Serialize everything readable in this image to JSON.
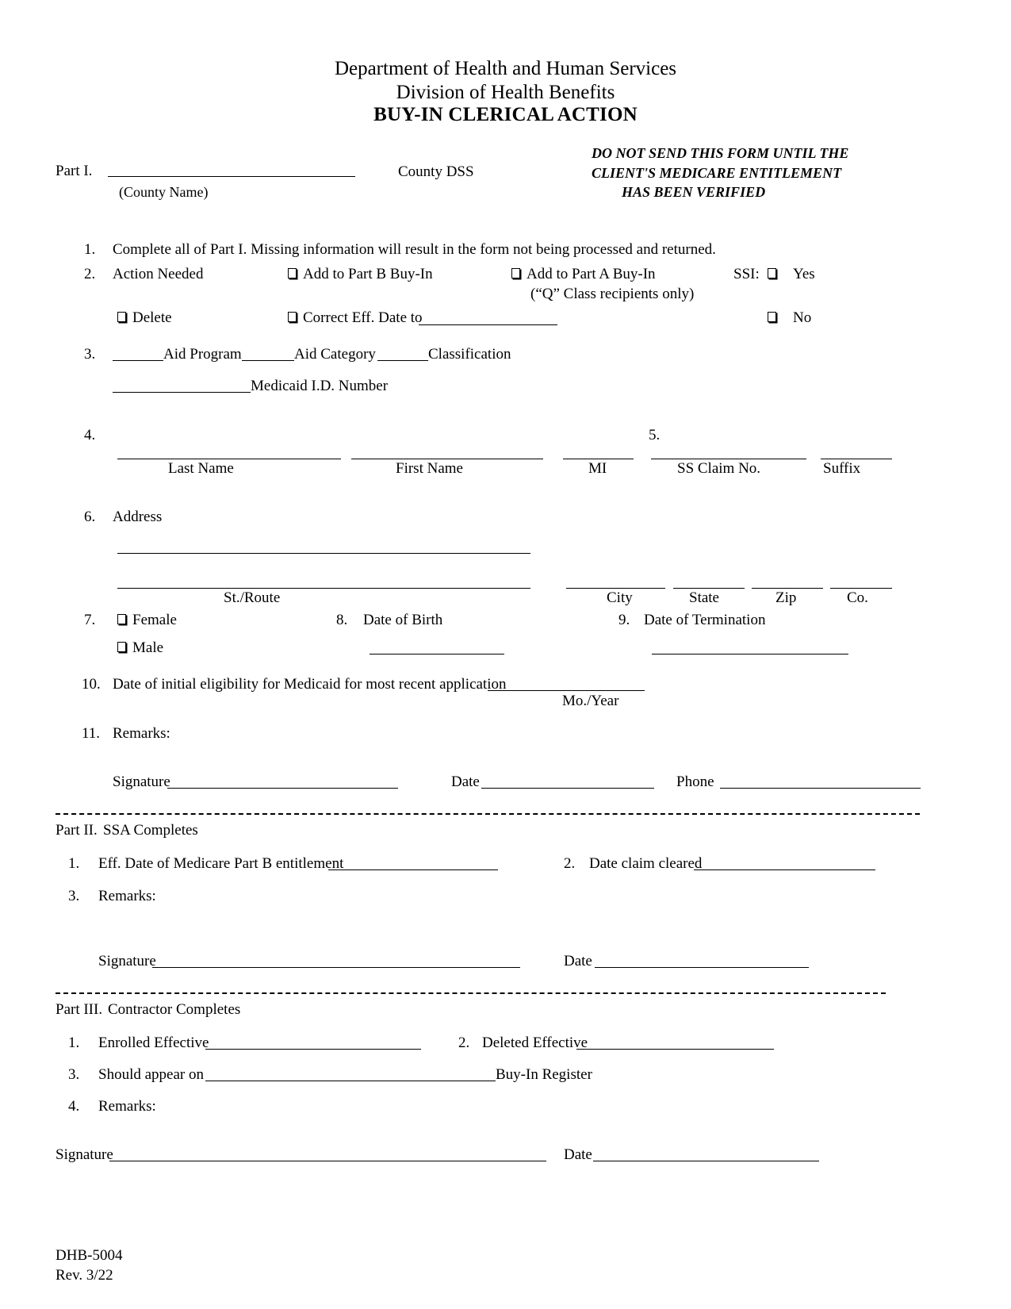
{
  "header": {
    "line1": "Department of Health and Human Services",
    "line2": "Division of Health Benefits",
    "title": "BUY-IN CLERICAL ACTION"
  },
  "part1": {
    "label": "Part I.",
    "county_caption": "(County  Name)",
    "county_dss": "County DSS",
    "notice": {
      "line1": "DO NOT SEND THIS FORM UNTIL THE",
      "line2": "CLIENT'S MEDICARE ENTITLEMENT",
      "line3": "HAS BEEN VERIFIED"
    },
    "items": {
      "n1": "1.",
      "i1_text": "Complete all of Part I. Missing information will result in the form not being processed and returned.",
      "n2": "2.",
      "i2_text": "Action Needed",
      "cb_add_b": "Add to Part B Buy-In",
      "cb_add_a": "Add to Part A  Buy-In",
      "ssi_label": "SSI:",
      "ssi_yes": "Yes",
      "ssi_no": "No",
      "q_class_note": "(“Q” Class recipients only)",
      "cb_delete": "Delete",
      "cb_correct": "Correct Eff. Date to",
      "n3": "3.",
      "aid_program": "Aid Program",
      "aid_category": "Aid Category",
      "classification": "Classification",
      "medicaid_id": "Medicaid I.D. Number",
      "n4": "4.",
      "n5": "5.",
      "lbl_last_name": "Last Name",
      "lbl_first_name": "First Name",
      "lbl_mi": "MI",
      "lbl_ss_claim": "SS Claim No.",
      "lbl_suffix": "Suffix",
      "n6": "6.",
      "i6_text": "Address",
      "lbl_st_route": "St./Route",
      "lbl_city": "City",
      "lbl_state": "State",
      "lbl_zip": "Zip",
      "lbl_co": "Co.",
      "n7": "7.",
      "cb_female": "Female",
      "cb_male": "Male",
      "n8": "8.",
      "i8_text": "Date of Birth",
      "n9": "9.",
      "i9_text": "Date of Termination",
      "n10": "10.",
      "i10_text": "Date of initial eligibility for Medicaid for most recent application",
      "lbl_mo_year": "Mo./Year",
      "n11": "11.",
      "i11_text": "Remarks:",
      "sig_label": "Signature",
      "date_label": "Date",
      "phone_label": "Phone"
    }
  },
  "part2": {
    "label": "Part II.",
    "title": "SSA Completes",
    "n1": "1.",
    "i1_text": "Eff. Date of Medicare Part B entitlement",
    "n2": "2.",
    "i2_text": "Date claim cleared",
    "n3": "3.",
    "i3_text": "Remarks:",
    "sig_label": "Signature",
    "date_label": "Date"
  },
  "part3": {
    "label": "Part III.",
    "title": "Contractor Completes",
    "n1": "1.",
    "i1_text": "Enrolled Effective",
    "n2": "2.",
    "i2_text": "Deleted Effective",
    "n3": "3.",
    "i3_text": "Should appear on",
    "i3_suffix": "Buy-In Register",
    "n4": "4.",
    "i4_text": "Remarks:",
    "sig_label": "Signature",
    "date_label": "Date"
  },
  "footer": {
    "form_number": "DHB-5004",
    "revision": "Rev. 3/22"
  }
}
